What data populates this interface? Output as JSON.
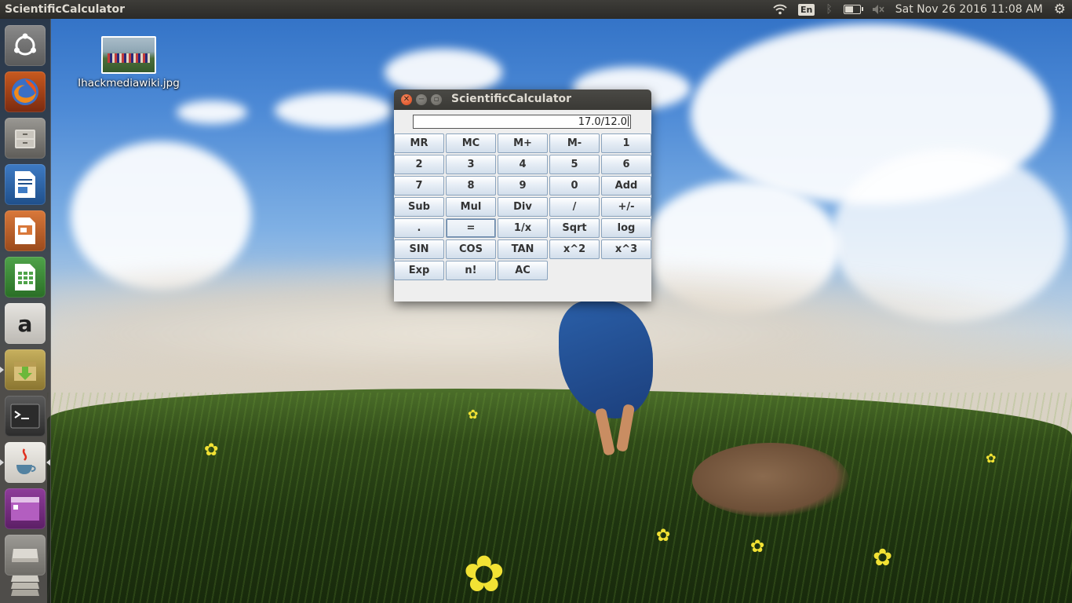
{
  "top_panel": {
    "app_title": "ScientificCalculator",
    "keyboard_layout": "En",
    "battery_level": 0.6,
    "datetime": "Sat Nov 26 2016 11:08 AM"
  },
  "launcher": {
    "items": [
      {
        "name": "ubuntu-dash",
        "icon": "ubuntu-logo-icon"
      },
      {
        "name": "firefox",
        "icon": "firefox-icon"
      },
      {
        "name": "files",
        "icon": "file-cabinet-icon"
      },
      {
        "name": "libreoffice-writer",
        "icon": "writer-document-icon"
      },
      {
        "name": "libreoffice-impress",
        "icon": "impress-presentation-icon"
      },
      {
        "name": "libreoffice-calc",
        "icon": "calc-spreadsheet-icon"
      },
      {
        "name": "amazon",
        "icon": "amazon-logo-icon"
      },
      {
        "name": "software-updater",
        "icon": "package-download-icon"
      },
      {
        "name": "terminal",
        "icon": "terminal-icon"
      },
      {
        "name": "java",
        "icon": "java-cup-icon"
      },
      {
        "name": "workspace-switcher",
        "icon": "workspace-icon"
      },
      {
        "name": "drive",
        "icon": "drive-icon"
      },
      {
        "name": "trash-stack",
        "icon": "stack-icon"
      }
    ]
  },
  "desktop": {
    "file_icon_label": "Ihackmediawiki.jpg"
  },
  "calculator": {
    "window_title": "ScientificCalculator",
    "display_value": "17.0/12.0",
    "keys": [
      [
        "MR",
        "MC",
        "M+",
        "M-",
        "1"
      ],
      [
        "2",
        "3",
        "4",
        "5",
        "6"
      ],
      [
        "7",
        "8",
        "9",
        "0",
        "Add"
      ],
      [
        "Sub",
        "Mul",
        "Div",
        "/",
        "+/-"
      ],
      [
        ".",
        "=",
        "1/x",
        "Sqrt",
        "log"
      ],
      [
        "SIN",
        "COS",
        "TAN",
        "x^2",
        "x^3"
      ],
      [
        "Exp",
        "n!",
        "AC"
      ]
    ]
  }
}
